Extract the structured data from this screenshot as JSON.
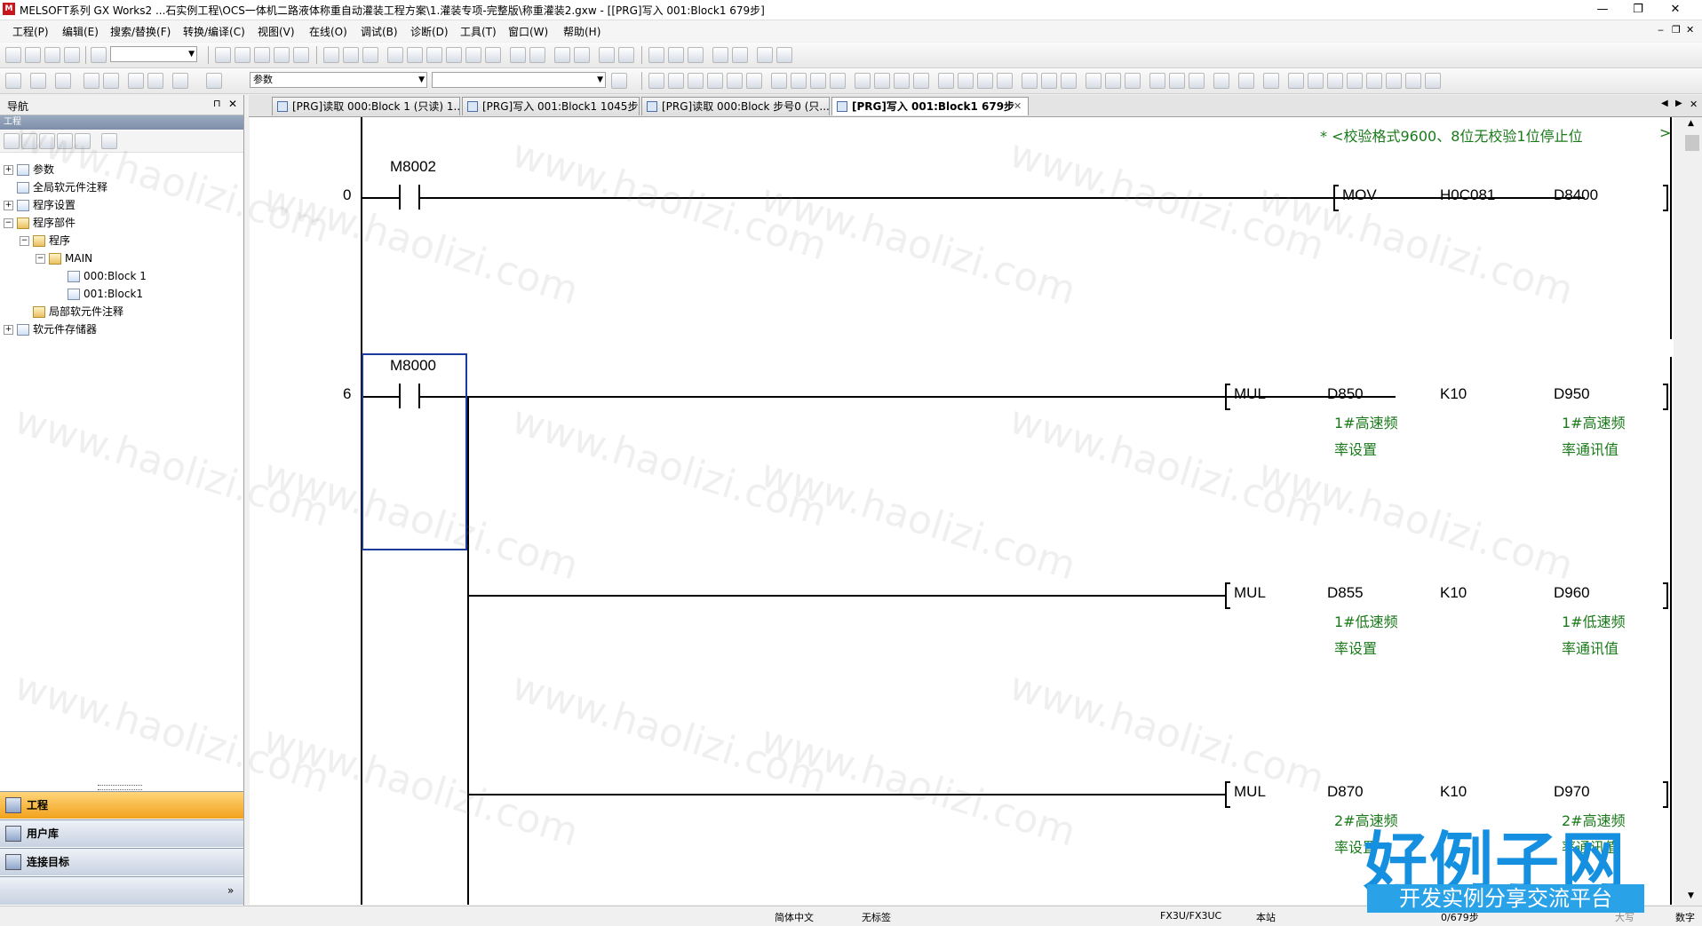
{
  "titlebar": {
    "app_icon": "melsoft-icon",
    "title": "MELSOFT系列 GX Works2 ...石实例工程\\OCS一体机二路液体称重自动灌装工程方案\\1.灌装专项-完整版\\称重灌装2.gxw - [[PRG]写入 001:Block1 679步]",
    "minimize": "—",
    "restore": "❐",
    "close": "✕"
  },
  "menu": {
    "items": [
      "工程(P)",
      "编辑(E)",
      "搜索/替换(F)",
      "转换/编译(C)",
      "视图(V)",
      "在线(O)",
      "调试(B)",
      "诊断(D)",
      "工具(T)",
      "窗口(W)",
      "帮助(H)"
    ],
    "mdi_min": "‒",
    "mdi_restore": "❐",
    "mdi_close": "✕"
  },
  "toolbar2": {
    "combo_value": "参数"
  },
  "nav": {
    "title": "导航",
    "pin": "⊓",
    "close": "✕",
    "section": "工程",
    "tree": [
      {
        "label": "参数",
        "level": 0,
        "exp": "+"
      },
      {
        "label": "全局软元件注释",
        "level": 0,
        "exp": ""
      },
      {
        "label": "程序设置",
        "level": 0,
        "exp": "+"
      },
      {
        "label": "程序部件",
        "level": 0,
        "exp": "−"
      },
      {
        "label": "程序",
        "level": 1,
        "exp": "−"
      },
      {
        "label": "MAIN",
        "level": 2,
        "exp": "−"
      },
      {
        "label": "000:Block 1",
        "level": 3,
        "exp": ""
      },
      {
        "label": "001:Block1",
        "level": 3,
        "exp": ""
      },
      {
        "label": "局部软元件注释",
        "level": 1,
        "exp": ""
      },
      {
        "label": "软元件存储器",
        "level": 0,
        "exp": "+"
      }
    ],
    "bottom_tabs": [
      "工程",
      "用户库",
      "连接目标"
    ],
    "more": "»"
  },
  "tabs": [
    "[PRG]读取 000:Block 1 (只读) 1...",
    "[PRG]写入 001:Block1 1045步",
    "[PRG]读取 000:Block 步号0 (只...",
    "[PRG]写入 001:Block1 679步"
  ],
  "ladder": {
    "comment": "* <校验格式9600、8位无校验1位停止位",
    "comment_end": ">",
    "rungs": [
      {
        "step": "0",
        "contact": "M8002",
        "instr": "MOV",
        "op1": "H0C081",
        "op2": "D8400"
      },
      {
        "step": "6",
        "contact": "M8000",
        "instr": "MUL",
        "op1": "D850",
        "op2": "K10",
        "op3": "D950",
        "c1": [
          "1#高速频",
          "率设置"
        ],
        "c3": [
          "1#高速频",
          "率通讯值"
        ]
      },
      {
        "instr": "MUL",
        "op1": "D855",
        "op2": "K10",
        "op3": "D960",
        "c1": [
          "1#低速频",
          "率设置"
        ],
        "c3": [
          "1#低速频",
          "率通讯值"
        ]
      },
      {
        "instr": "MUL",
        "op1": "D870",
        "op2": "K10",
        "op3": "D970",
        "c1": [
          "2#高速频",
          "率设置"
        ],
        "c3": [
          "2#高速频",
          "率通讯值"
        ]
      }
    ]
  },
  "statusbar": {
    "lang": "简体中文",
    "label": "无标签",
    "cpu": "FX3U/FX3UC",
    "station": "本站",
    "steps": "0/679步",
    "caps": "大写",
    "num": "数字"
  },
  "watermark": "www.haolizi.com",
  "logo": {
    "main": "好例子网",
    "sub": "开发实例分享交流平台"
  }
}
